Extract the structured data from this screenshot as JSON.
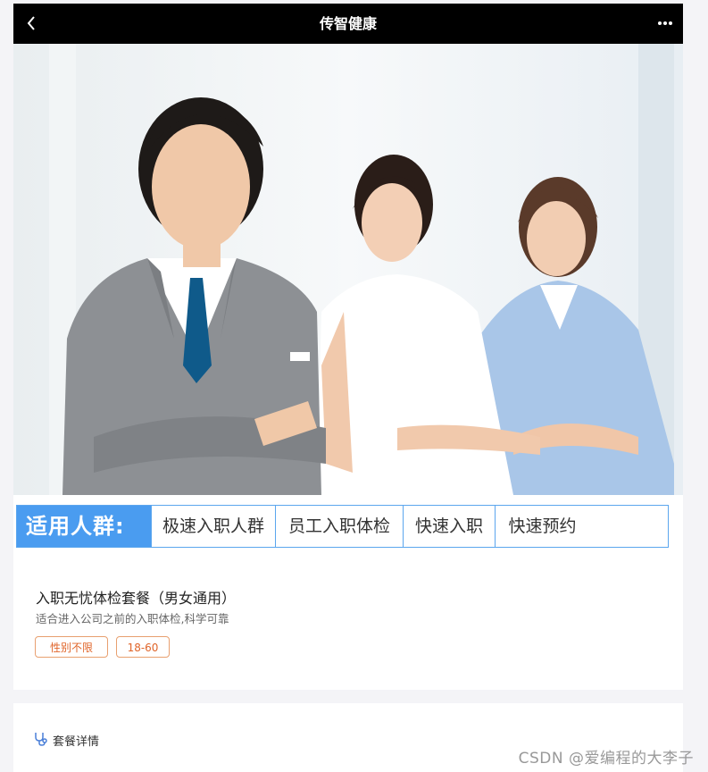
{
  "header": {
    "title": "传智健康",
    "back_icon": "chevron-left-icon",
    "more_icon": "more-dots-icon"
  },
  "banner": {
    "label": "适用人群:",
    "items": [
      "极速入职人群",
      "员工入职体检",
      "快速入职",
      "快速预约"
    ],
    "accent_color": "#4a9cf0"
  },
  "package": {
    "name": "入职无忧体检套餐（男女通用）",
    "description": "适合进入公司之前的入职体检,科学可靠",
    "tags": [
      "性别不限",
      "18-60"
    ],
    "tag_color": "#e0652a"
  },
  "details": {
    "label": "套餐详情",
    "icon": "stethoscope-icon"
  },
  "watermark": "CSDN @爱编程的大李子"
}
